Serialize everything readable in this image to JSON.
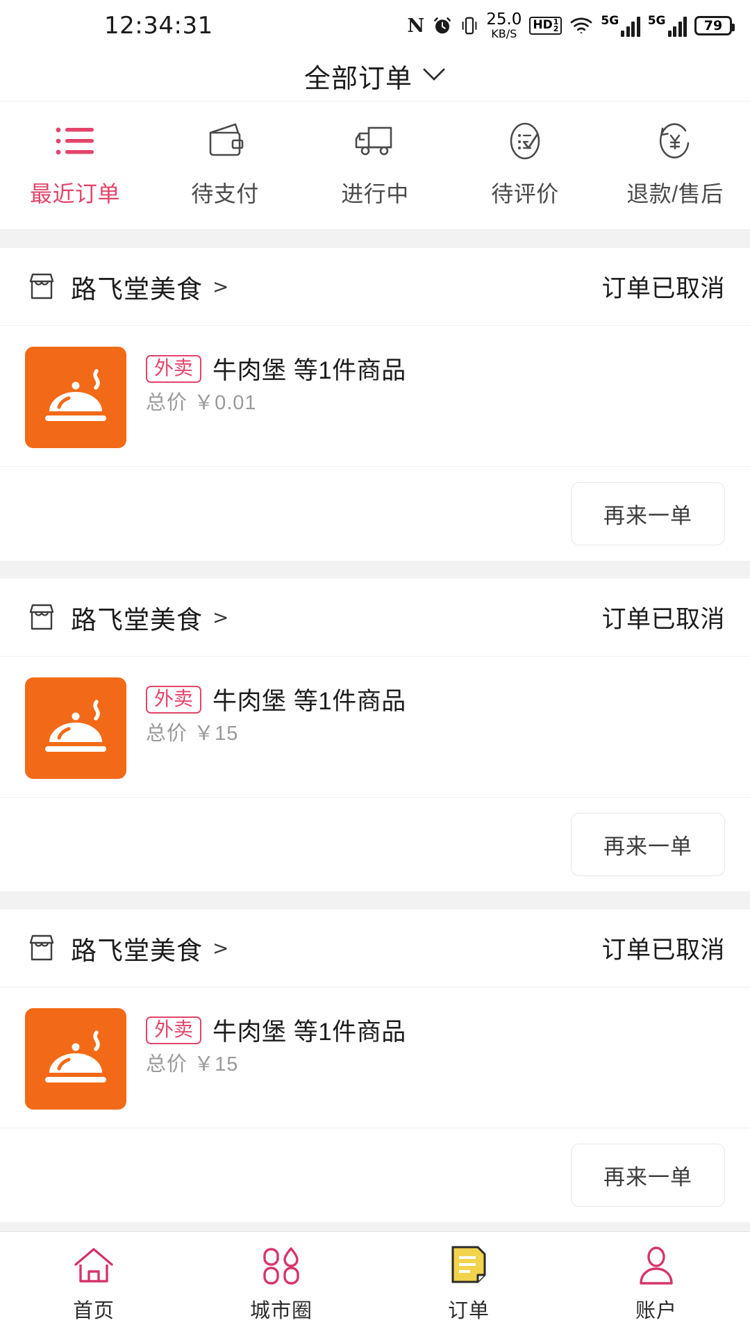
{
  "statusbar": {
    "time": "12:34:31",
    "nfc": "N",
    "netspeed_value": "25.0",
    "netspeed_unit": "KB/S",
    "hd_label": "HD",
    "hd_sup": "1",
    "hd_sub": "2",
    "sim1_label": "5G",
    "sim2_label": "5G",
    "battery": "79"
  },
  "header": {
    "title": "全部订单",
    "dropdown_icon": "chevron-down-icon"
  },
  "tabs": [
    {
      "label": "最近订单",
      "icon": "list-icon",
      "active": true
    },
    {
      "label": "待支付",
      "icon": "wallet-icon",
      "active": false
    },
    {
      "label": "进行中",
      "icon": "truck-icon",
      "active": false
    },
    {
      "label": "待评价",
      "icon": "review-icon",
      "active": false
    },
    {
      "label": "退款/售后",
      "icon": "refund-icon",
      "active": false
    }
  ],
  "orders": [
    {
      "shop_name": "路飞堂美食",
      "shop_icon": "storefront-icon",
      "chevron": ">",
      "status": "订单已取消",
      "thumb_icon": "food-cloche-icon",
      "badge": "外卖",
      "goods": "牛肉堡 等1件商品",
      "price_label": "总价",
      "currency": "￥",
      "price_value": "0.01",
      "action_label": "再来一单"
    },
    {
      "shop_name": "路飞堂美食",
      "shop_icon": "storefront-icon",
      "chevron": ">",
      "status": "订单已取消",
      "thumb_icon": "food-cloche-icon",
      "badge": "外卖",
      "goods": "牛肉堡 等1件商品",
      "price_label": "总价",
      "currency": "￥",
      "price_value": "15",
      "action_label": "再来一单"
    },
    {
      "shop_name": "路飞堂美食",
      "shop_icon": "storefront-icon",
      "chevron": ">",
      "status": "订单已取消",
      "thumb_icon": "food-cloche-icon",
      "badge": "外卖",
      "goods": "牛肉堡 等1件商品",
      "price_label": "总价",
      "currency": "￥",
      "price_value": "15",
      "action_label": "再来一单"
    }
  ],
  "bottomnav": [
    {
      "label": "首页",
      "icon": "home-icon",
      "active": false
    },
    {
      "label": "城市圈",
      "icon": "city-circle-icon",
      "active": false
    },
    {
      "label": "订单",
      "icon": "order-doc-icon",
      "active": true
    },
    {
      "label": "账户",
      "icon": "account-person-icon",
      "active": false
    }
  ],
  "colors": {
    "accent_pink": "#e2456a",
    "thumb_orange": "#f26a17",
    "order_active_yellow": "#f2d34b",
    "page_bg": "#f2f2f2",
    "card_bg": "#ffffff",
    "text_primary": "#1c1c1c",
    "text_muted": "#9a9a9a"
  }
}
